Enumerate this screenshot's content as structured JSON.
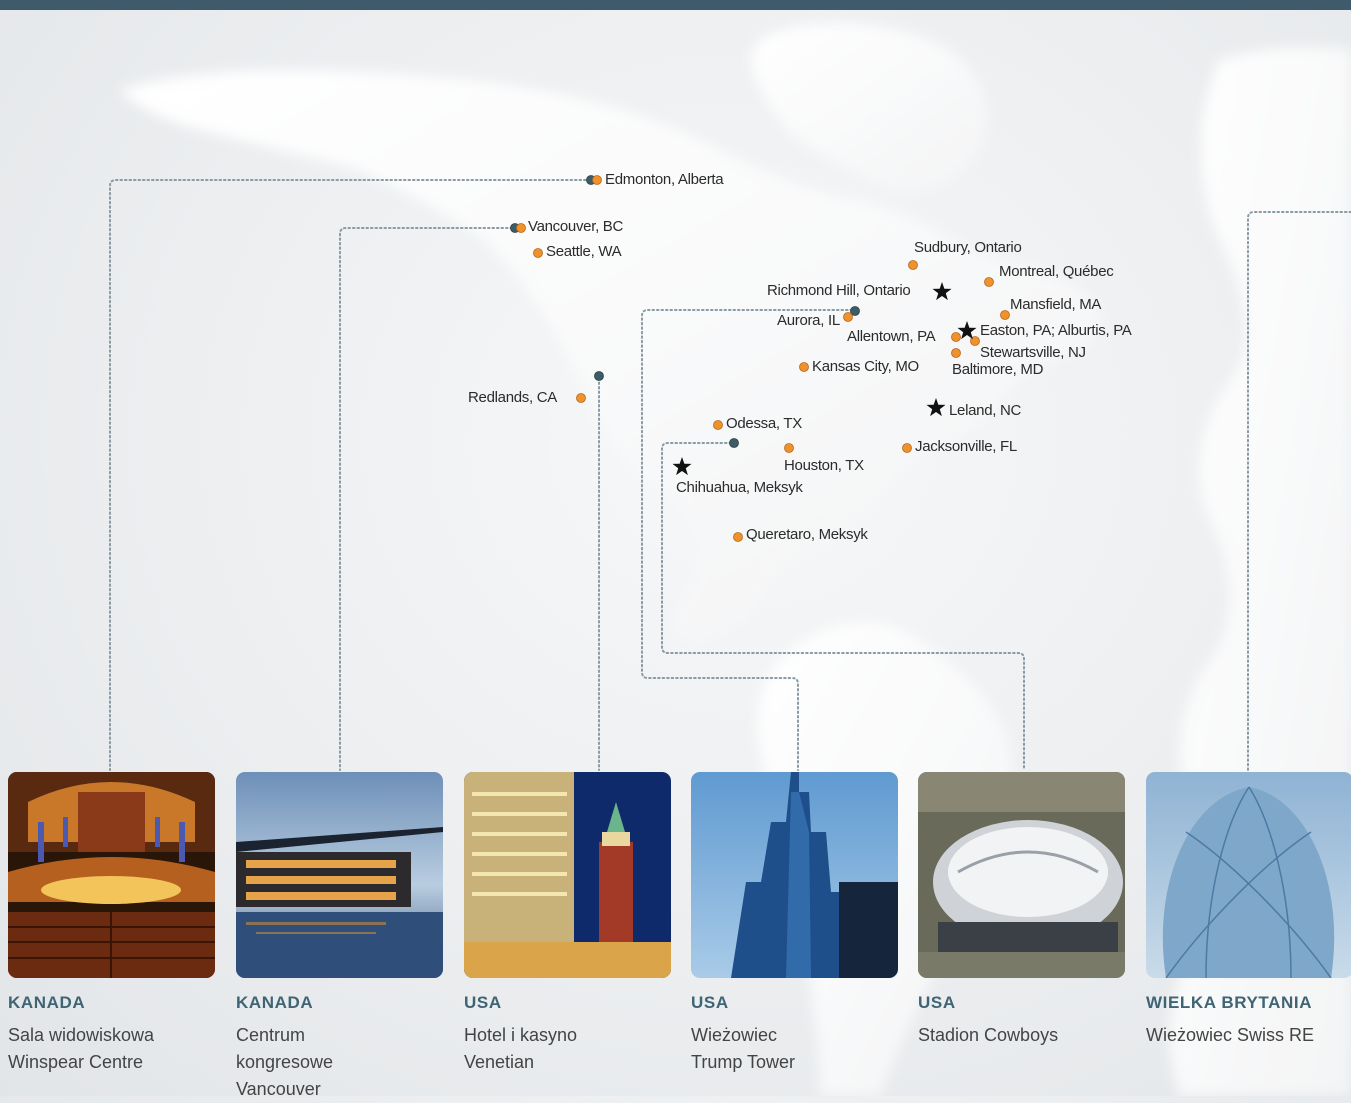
{
  "locations": [
    {
      "id": "edmonton",
      "label": "Edmonton, Alberta"
    },
    {
      "id": "vancouver",
      "label": "Vancouver, BC"
    },
    {
      "id": "seattle",
      "label": "Seattle, WA"
    },
    {
      "id": "sudbury",
      "label": "Sudbury, Ontario"
    },
    {
      "id": "montreal",
      "label": "Montreal, Québec"
    },
    {
      "id": "richmond-hill",
      "label": "Richmond Hill, Ontario"
    },
    {
      "id": "mansfield",
      "label": "Mansfield, MA"
    },
    {
      "id": "aurora",
      "label": "Aurora, IL"
    },
    {
      "id": "allentown",
      "label": "Allentown, PA"
    },
    {
      "id": "easton",
      "label": "Easton, PA; Alburtis, PA"
    },
    {
      "id": "stewartsville",
      "label": "Stewartsville, NJ"
    },
    {
      "id": "baltimore",
      "label": "Baltimore, MD"
    },
    {
      "id": "kansas-city",
      "label": "Kansas City, MO"
    },
    {
      "id": "redlands",
      "label": "Redlands, CA"
    },
    {
      "id": "leland",
      "label": "Leland, NC"
    },
    {
      "id": "odessa",
      "label": "Odessa, TX"
    },
    {
      "id": "jacksonville",
      "label": "Jacksonville, FL"
    },
    {
      "id": "houston",
      "label": "Houston, TX"
    },
    {
      "id": "chihuahua",
      "label": "Chihuahua, Meksyk"
    },
    {
      "id": "queretaro",
      "label": "Queretaro, Meksyk"
    }
  ],
  "projects": [
    {
      "country": "KANADA",
      "name": "Sala widowiskowa Winspear Centre"
    },
    {
      "country": "KANADA",
      "name": "Centrum kongresowe Vancouver"
    },
    {
      "country": "USA",
      "name": "Hotel i kasyno Venetian"
    },
    {
      "country": "USA",
      "name": "Wieżowiec Trump Tower"
    },
    {
      "country": "USA",
      "name": "Stadion Cowboys"
    },
    {
      "country": "WIELKA BRYTANIA",
      "name": "Wieżowiec Swiss RE"
    }
  ],
  "colors": {
    "header_bar": "#3f5b6b",
    "facility_dot": "#f0922b",
    "project_dot": "#3e5c66",
    "headquarters_star": "#111111",
    "connector_line": "#8a9aa3",
    "country_text": "#3f6474"
  }
}
